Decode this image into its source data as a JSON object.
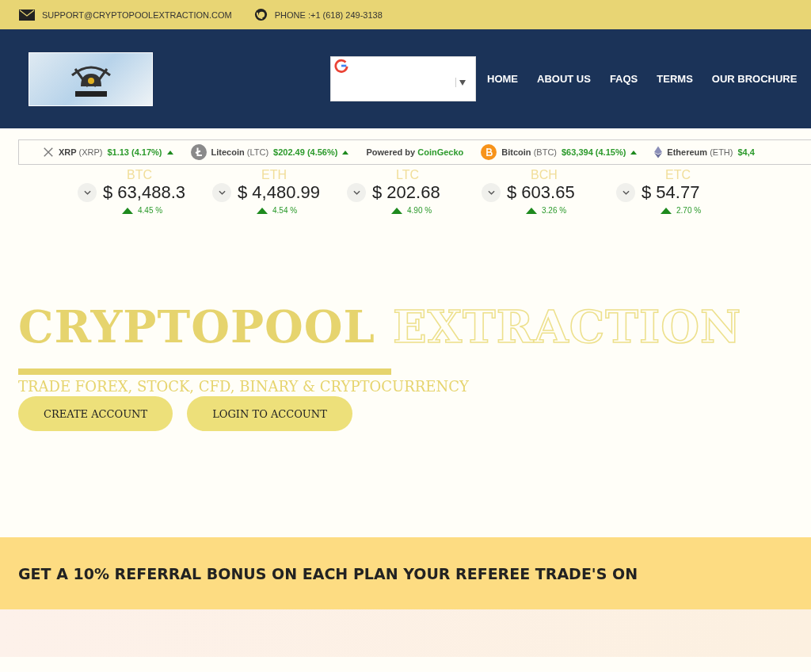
{
  "contact_bar": {
    "email": "SUPPORT@CRYPTOPOOLEXTRACTION.COM",
    "phone": "PHONE :+1 (618) 249-3138"
  },
  "nav": {
    "items": [
      {
        "label": "HOME"
      },
      {
        "label": "ABOUT US"
      },
      {
        "label": "FAQS"
      },
      {
        "label": "TERMS"
      },
      {
        "label": "OUR BROCHURE"
      }
    ]
  },
  "ticker": {
    "items": [
      {
        "kind": "coin",
        "name": "XRP",
        "symbol": "(XRP)",
        "price": "$1.13 (4.17%)"
      },
      {
        "kind": "coin",
        "name": "Litecoin",
        "symbol": "(LTC)",
        "price": "$202.49 (4.56%)"
      },
      {
        "kind": "credit",
        "text": "Powered by",
        "brand": "CoinGecko"
      },
      {
        "kind": "coin",
        "name": "Bitcoin",
        "symbol": "(BTC)",
        "price": "$63,394 (4.15%)"
      },
      {
        "kind": "coin",
        "name": "Ethereum",
        "symbol": "(ETH)",
        "price": "$4,4"
      }
    ]
  },
  "price_cards": [
    {
      "symbol": "BTC",
      "price": "$ 63,488.3",
      "change": "4.45 %"
    },
    {
      "symbol": "ETH",
      "price": "$ 4,480.99",
      "change": "4.54 %"
    },
    {
      "symbol": "LTC",
      "price": "$ 202.68",
      "change": "4.90 %"
    },
    {
      "symbol": "BCH",
      "price": "$ 603.65",
      "change": "3.26 %"
    },
    {
      "symbol": "ETC",
      "price": "$ 54.77",
      "change": "2.70 %"
    }
  ],
  "hero": {
    "title_solid": "CRYPTOPOOL",
    "title_outline": "EXTRACTION",
    "subtitle": "TRADE FOREX, STOCK, CFD, BINARY & CRYPTOCURRENCY",
    "buttons": [
      "CREATE ACCOUNT",
      "LOGIN TO ACCOUNT"
    ]
  },
  "banner": {
    "text": "GET A 10% REFERRAL BONUS ON EACH PLAN YOUR REFEREE TRADE'S ON"
  }
}
